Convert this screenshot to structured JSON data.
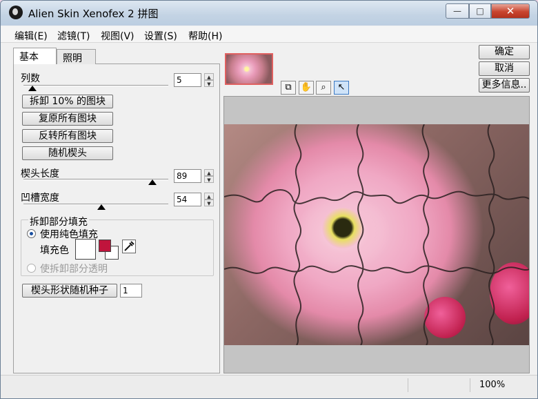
{
  "window": {
    "title": "Alien Skin Xenofex 2 拼图",
    "min_label": "—",
    "max_label": "□",
    "close_label": "✕"
  },
  "menu": [
    "编辑(E)",
    "滤镜(T)",
    "视图(V)",
    "设置(S)",
    "帮助(H)"
  ],
  "tabs": {
    "basic": "基本",
    "lighting": "照明"
  },
  "controls": {
    "columns_label": "列数",
    "columns_value": "5",
    "columns_level": 0.06,
    "btn_remove": "拆卸 10% 的图块",
    "btn_restore": "复原所有图块",
    "btn_invert": "反转所有图块",
    "btn_random": "随机楔头",
    "knob_length_label": "楔头长度",
    "knob_length_value": "89",
    "knob_length_level": 0.89,
    "groove_width_label": "凹槽宽度",
    "groove_width_value": "54",
    "groove_width_level": 0.54
  },
  "fill_group": {
    "title": "拆卸部分填充",
    "option_solid": "使用纯色填充",
    "fill_color_label": "填充色",
    "fill_color_primary": "#ffffff",
    "fill_color_secondary": "#c0143c",
    "option_transparent": "使拆卸部分透明"
  },
  "seed": {
    "button_label": "楔头形状随机种子",
    "value": "1"
  },
  "side_buttons": {
    "ok": "确定",
    "cancel": "取消",
    "more_info": "更多信息.."
  },
  "status": {
    "zoom": "100%"
  },
  "colors": {
    "accent": "#3a78c3",
    "close_red": "#c8442e"
  },
  "icons": {
    "tool_compare": "compare-icon",
    "tool_hand": "hand-icon",
    "tool_zoom": "magnifier-icon",
    "tool_arrow": "arrow-pointer-icon",
    "eyedropper": "eyedropper-icon"
  }
}
